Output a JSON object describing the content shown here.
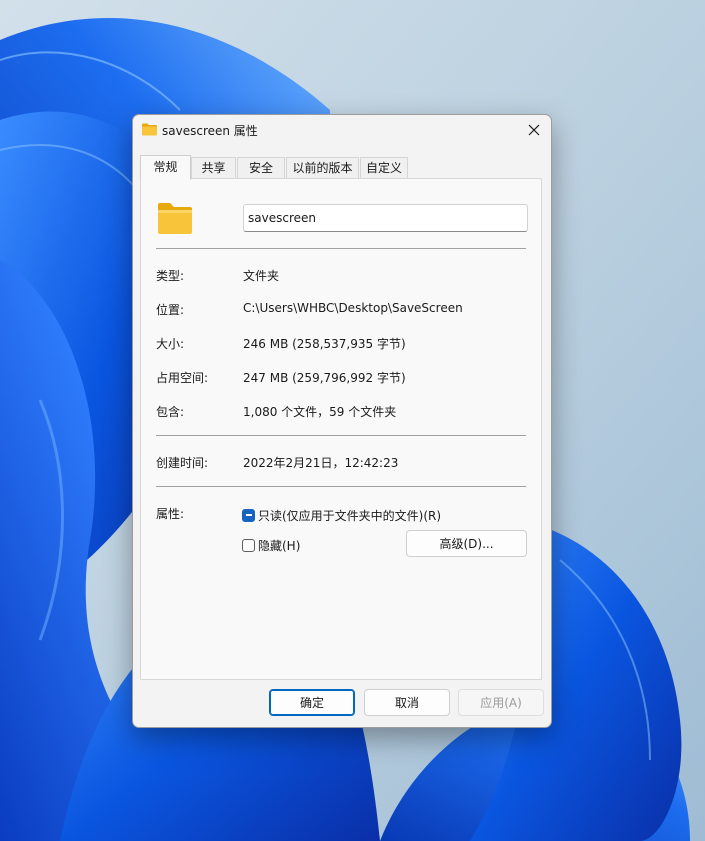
{
  "window": {
    "title": "savescreen 属性",
    "close_label": "关闭"
  },
  "tabs": [
    {
      "label": "常规",
      "active": true
    },
    {
      "label": "共享",
      "active": false
    },
    {
      "label": "安全",
      "active": false
    },
    {
      "label": "以前的版本",
      "active": false
    },
    {
      "label": "自定义",
      "active": false
    }
  ],
  "general": {
    "folder_icon": "folder-icon",
    "name_value": "savescreen",
    "type": {
      "label": "类型:",
      "value": "文件夹"
    },
    "location": {
      "label": "位置:",
      "value": "C:\\Users\\WHBC\\Desktop\\SaveScreen"
    },
    "size": {
      "label": "大小:",
      "value": "246 MB (258,537,935 字节)"
    },
    "size_on_disk": {
      "label": "占用空间:",
      "value": "247 MB (259,796,992 字节)"
    },
    "contains": {
      "label": "包含:",
      "value": "1,080 个文件，59 个文件夹"
    },
    "created": {
      "label": "创建时间:",
      "value": "2022年2月21日，12:42:23"
    },
    "attributes": {
      "label": "属性:",
      "readonly": {
        "label": "只读(仅应用于文件夹中的文件)(R)",
        "state": "indeterminate"
      },
      "hidden": {
        "label": "隐藏(H)",
        "state": "unchecked"
      },
      "advanced_button": "高级(D)..."
    }
  },
  "footer": {
    "ok": "确定",
    "cancel": "取消",
    "apply": "应用(A)"
  },
  "colors": {
    "accent": "#0067c0",
    "checkbox_fill": "#1565c0",
    "folder_yellow": "#f8c43a",
    "wallpaper_blue": "#0a56e0",
    "wallpaper_bg": "#b8cfe0"
  }
}
